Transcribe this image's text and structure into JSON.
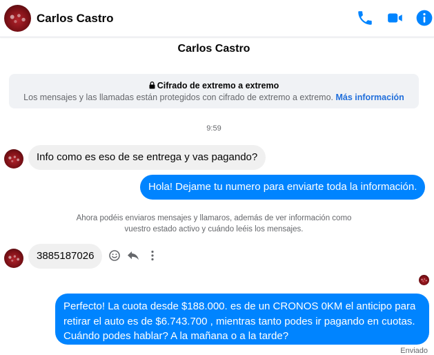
{
  "header": {
    "contact_name": "Carlos Castro",
    "icons": [
      "phone-icon",
      "video-camera-icon",
      "info-icon"
    ]
  },
  "conversation": {
    "title": "Carlos Castro",
    "encryption": {
      "title": "Cifrado de extremo a extremo",
      "text": "Los mensajes y las llamadas están protegidos con cifrado de extremo a extremo.",
      "link": "Más información"
    },
    "timestamp": "9:59",
    "messages": [
      {
        "from": "contact",
        "text": "Info como es eso de se entrega y vas pagando?"
      },
      {
        "from": "me",
        "text": "Hola! Dejame tu numero  para enviarte toda la información."
      },
      {
        "from": "contact",
        "text": "3885187026"
      },
      {
        "from": "me",
        "lines": [
          "Perfecto! La cuota desde $188.000. es de un CRONOS 0KM el anticipo para",
          "retirar el auto es de $6.743.700 , mientras tanto podes ir pagando en cuotas.",
          "Cuándo podes hablar? A la mañana o a la tarde?"
        ]
      }
    ],
    "notice_lines": [
      "Ahora podéis enviaros mensajes y llamaros, además de ver información como",
      "vuestro estado activo y cuándo leéis los mensajes."
    ],
    "status": "Enviado"
  },
  "colors": {
    "accent": "#0084ff",
    "link": "#216fdb",
    "incoming_bubble": "#f0f0f0",
    "muted_text": "#65676b"
  }
}
